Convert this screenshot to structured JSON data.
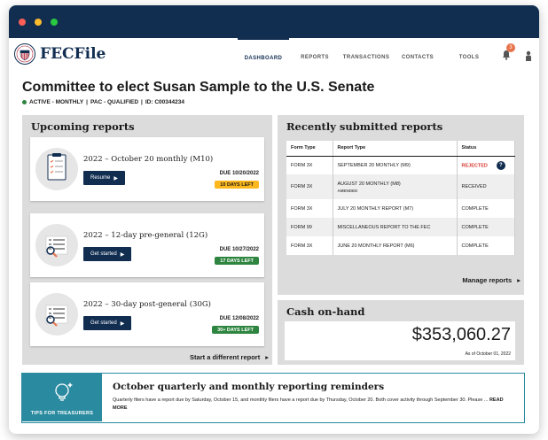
{
  "window": {
    "dot_colors": [
      "#ff5f57",
      "#febc2e",
      "#28c840"
    ]
  },
  "nav": {
    "brand": "FECFile",
    "links": [
      "DASHBOARD",
      "REPORTS",
      "TRANSACTIONS",
      "CONTACTS",
      "TOOLS"
    ],
    "active_link": "DASHBOARD",
    "notification_count": "3"
  },
  "committee": {
    "title": "Committee to elect Susan Sample to the U.S. Senate",
    "status": "ACTIVE - MONTHLY",
    "type": "PAC - QUALIFIED",
    "id": "ID: C00344234"
  },
  "upcoming": {
    "title": "Upcoming reports",
    "reports": [
      {
        "name": "2022 – October 20 monthly  (M10)",
        "button": "Resume",
        "due": "DUE 10/20/2022",
        "badge": "10 DAYS LEFT",
        "badge_type": "warn"
      },
      {
        "name": "2022 – 12-day pre-general (12G)",
        "button": "Get started",
        "due": "DUE 10/27/2022",
        "badge": "17 DAYS LEFT",
        "badge_type": "ok"
      },
      {
        "name": "2022 – 30-day post-general (30G)",
        "button": "Get started",
        "due": "DUE 12/08/2022",
        "badge": "30+ DAYS LEFT",
        "badge_type": "ok"
      }
    ],
    "start_link": "Start a different report"
  },
  "recent": {
    "title": "Recently submitted reports",
    "columns": [
      "Form Type",
      "Report Type",
      "Status"
    ],
    "rows": [
      {
        "form": "FORM 3X",
        "report": "SEPTEMBER 20 MONTHLY (M9)",
        "status": "REJECTED",
        "note": ""
      },
      {
        "form": "FORM 3X",
        "report": "AUGUST 20 MONTHLY (M8)",
        "status": "RECEIVED",
        "note": "AMENDED"
      },
      {
        "form": "FORM 3X",
        "report": "JULY 20 MONTHLY REPORT (M7)",
        "status": "COMPLETE",
        "note": ""
      },
      {
        "form": "FORM 99",
        "report": "MISCELLANEOUS REPORT TO THE FEC",
        "status": "COMPLETE",
        "note": ""
      },
      {
        "form": "FORM 3X",
        "report": "JUNE 20 MONTHLY REPORT (M6)",
        "status": "COMPLETE",
        "note": ""
      }
    ],
    "manage_link": "Manage reports"
  },
  "cash": {
    "title": "Cash on-hand",
    "amount": "$353,060.27",
    "as_of": "As of October 01, 2022"
  },
  "tips": {
    "label": "TIPS FOR TREASURERS",
    "title": "October quarterly and monthly reporting reminders",
    "body": "Quarterly filers have a report due by Saturday, October 15, and monthly filers have a report due by Thursday, October 20. Both cover activity through September 30. Please ...",
    "more": "READ MORE"
  }
}
